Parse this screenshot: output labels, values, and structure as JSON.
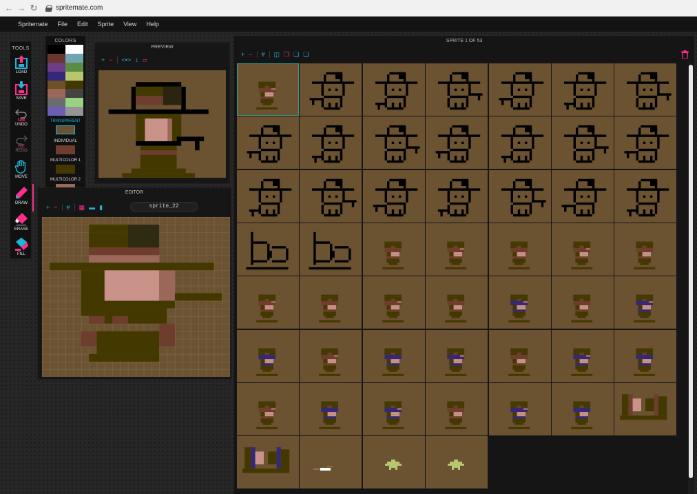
{
  "browser": {
    "url": "spritemate.com"
  },
  "menu": {
    "items": [
      "Spritemate",
      "File",
      "Edit",
      "Sprite",
      "View",
      "Help"
    ]
  },
  "tools": {
    "title": "TOOLS",
    "items": [
      {
        "label": "LOAD",
        "icon": "load-icon",
        "active": false
      },
      {
        "label": "SAVE",
        "icon": "save-icon",
        "active": false
      },
      {
        "label": "UNDO",
        "icon": "undo-icon",
        "active": false
      },
      {
        "label": "REDO",
        "icon": "redo-icon",
        "active": false
      },
      {
        "label": "MOVE",
        "icon": "hand-icon",
        "active": false
      },
      {
        "label": "DRAW",
        "icon": "pencil-icon",
        "active": true
      },
      {
        "label": "ERASE",
        "icon": "eraser-icon",
        "active": false
      },
      {
        "label": "FILL",
        "icon": "bucket-icon",
        "active": false
      }
    ]
  },
  "colors": {
    "title": "COLORS",
    "palette": [
      "#000000",
      "#ffffff",
      "#68372b",
      "#70a4b2",
      "#6f3d86",
      "#588d43",
      "#352879",
      "#b8c76f",
      "#6f4f25",
      "#433900",
      "#9a6759",
      "#444444",
      "#6c6c6c",
      "#9ad284",
      "#6c5eb5",
      "#959595"
    ],
    "transparent_label": "TRANSPARENT",
    "individual_label": "INDIVIDUAL",
    "multicolor1_label": "MULTICOLOR 1",
    "multicolor2_label": "MULTICOLOR 2",
    "transparent_color": "#6b5231",
    "individual_color": "#6f3d2d",
    "multicolor1_color": "#433900",
    "multicolor2_color": "#9a6759"
  },
  "preview": {
    "title": "PREVIEW",
    "background": "#6b5231"
  },
  "editor": {
    "title": "EDITOR",
    "sprite_name": "sprite_22"
  },
  "sprites": {
    "title": "SPRITE 1 OF 53"
  },
  "palette_accent": {
    "cyan": "#1fb5d8",
    "pink": "#ff2e8a"
  }
}
